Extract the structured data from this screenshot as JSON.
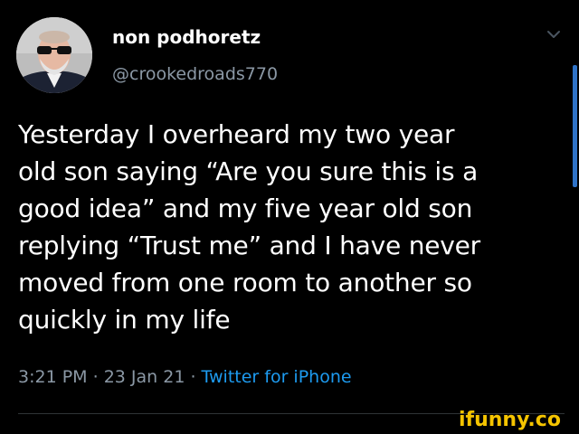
{
  "author": {
    "display_name": "non podhoretz",
    "handle": "@crookedroads770",
    "avatar_icon": "user-avatar-icon"
  },
  "tweet": {
    "lines": [
      "Yesterday I overheard my two year",
      "old son saying “Are you sure this is a",
      "good idea” and my five year old son",
      "replying “Trust me” and I have never",
      "moved from one room to another so",
      "quickly in my life"
    ],
    "time": "3:21 PM",
    "separator": " · ",
    "date": "23 Jan 21",
    "source": "Twitter for iPhone"
  },
  "watermark": {
    "text": "ifunny.co"
  },
  "colors": {
    "background": "#000000",
    "text": "#ffffff",
    "secondary": "#8b98a5",
    "link": "#1d9bf0",
    "watermark": "#f5c400",
    "scrollbar": "#2f73c8"
  },
  "icons": {
    "menu": "chevron-down-icon"
  }
}
